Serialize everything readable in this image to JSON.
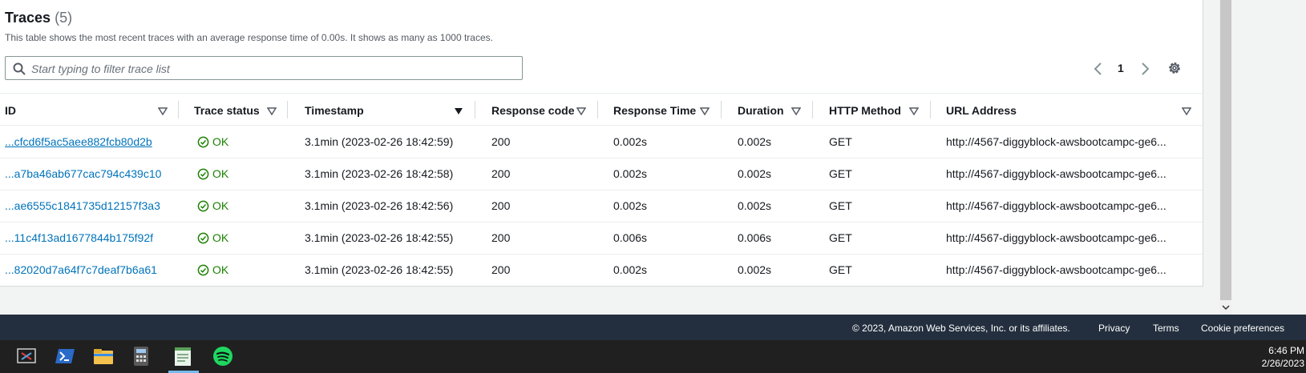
{
  "traces": {
    "title": "Traces",
    "count": "(5)",
    "description": "This table shows the most recent traces with an average response time of 0.00s. It shows as many as 1000 traces.",
    "search_placeholder": "Start typing to filter trace list",
    "page": "1"
  },
  "columns": [
    "ID",
    "Trace status",
    "Timestamp",
    "Response code",
    "Response Time",
    "Duration",
    "HTTP Method",
    "URL Address"
  ],
  "rows": [
    {
      "id": "...cfcd6f5ac5aee882fcb80d2b",
      "status": "OK",
      "timestamp": "3.1min (2023-02-26 18:42:59)",
      "code": "200",
      "response_time": "0.002s",
      "duration": "0.002s",
      "method": "GET",
      "url": "http://4567-diggyblock-awsbootcampc-ge6..."
    },
    {
      "id": "...a7ba46ab677cac794c439c10",
      "status": "OK",
      "timestamp": "3.1min (2023-02-26 18:42:58)",
      "code": "200",
      "response_time": "0.002s",
      "duration": "0.002s",
      "method": "GET",
      "url": "http://4567-diggyblock-awsbootcampc-ge6..."
    },
    {
      "id": "...ae6555c1841735d12157f3a3",
      "status": "OK",
      "timestamp": "3.1min (2023-02-26 18:42:56)",
      "code": "200",
      "response_time": "0.002s",
      "duration": "0.002s",
      "method": "GET",
      "url": "http://4567-diggyblock-awsbootcampc-ge6..."
    },
    {
      "id": "...11c4f13ad1677844b175f92f",
      "status": "OK",
      "timestamp": "3.1min (2023-02-26 18:42:55)",
      "code": "200",
      "response_time": "0.006s",
      "duration": "0.006s",
      "method": "GET",
      "url": "http://4567-diggyblock-awsbootcampc-ge6..."
    },
    {
      "id": "...82020d7a64f7c7deaf7b6a61",
      "status": "OK",
      "timestamp": "3.1min (2023-02-26 18:42:55)",
      "code": "200",
      "response_time": "0.002s",
      "duration": "0.002s",
      "method": "GET",
      "url": "http://4567-diggyblock-awsbootcampc-ge6..."
    }
  ],
  "footer": {
    "copyright": "© 2023, Amazon Web Services, Inc. or its affiliates.",
    "privacy": "Privacy",
    "terms": "Terms",
    "cookies": "Cookie preferences"
  },
  "taskbar": {
    "icons": [
      "snipping-tool-icon",
      "powershell-icon",
      "file-explorer-icon",
      "calculator-icon",
      "notepad-icon",
      "spotify-icon"
    ],
    "time": "6:46 PM",
    "date": "2/26/2023"
  },
  "colors": {
    "link": "#0073bb",
    "ok": "#1d8102",
    "footer_bg": "#232f3e",
    "taskbar_bg": "#202020"
  }
}
